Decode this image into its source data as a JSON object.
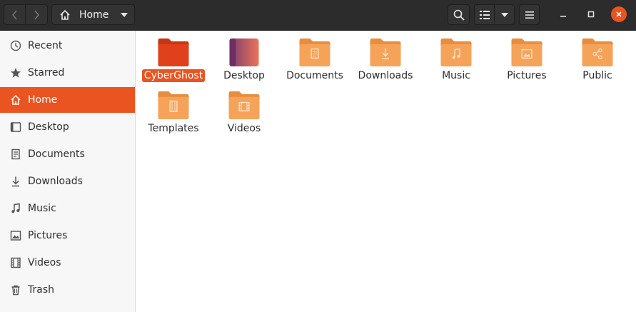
{
  "window": {
    "path_label": "Home"
  },
  "sidebar": {
    "items": [
      {
        "label": "Recent",
        "icon": "clock-icon"
      },
      {
        "label": "Starred",
        "icon": "star-icon"
      },
      {
        "label": "Home",
        "icon": "home-icon",
        "active": true
      },
      {
        "label": "Desktop",
        "icon": "desktop-icon"
      },
      {
        "label": "Documents",
        "icon": "document-icon"
      },
      {
        "label": "Downloads",
        "icon": "download-icon"
      },
      {
        "label": "Music",
        "icon": "music-icon"
      },
      {
        "label": "Pictures",
        "icon": "picture-icon"
      },
      {
        "label": "Videos",
        "icon": "video-icon"
      },
      {
        "label": "Trash",
        "icon": "trash-icon"
      }
    ]
  },
  "files": [
    {
      "name": "CyberGhost",
      "icon": "folder-red-icon",
      "selected": true
    },
    {
      "name": "Desktop",
      "icon": "folder-desktop-icon"
    },
    {
      "name": "Documents",
      "icon": "folder-documents-icon"
    },
    {
      "name": "Downloads",
      "icon": "folder-downloads-icon"
    },
    {
      "name": "Music",
      "icon": "folder-music-icon"
    },
    {
      "name": "Pictures",
      "icon": "folder-pictures-icon"
    },
    {
      "name": "Public",
      "icon": "folder-public-icon"
    },
    {
      "name": "Templates",
      "icon": "folder-templates-icon"
    },
    {
      "name": "Videos",
      "icon": "folder-videos-icon"
    }
  ],
  "colors": {
    "accent": "#e95420",
    "folder_orange": "#f6a35a",
    "folder_red": "#e0401c",
    "headerbar": "#2c2c2c"
  }
}
